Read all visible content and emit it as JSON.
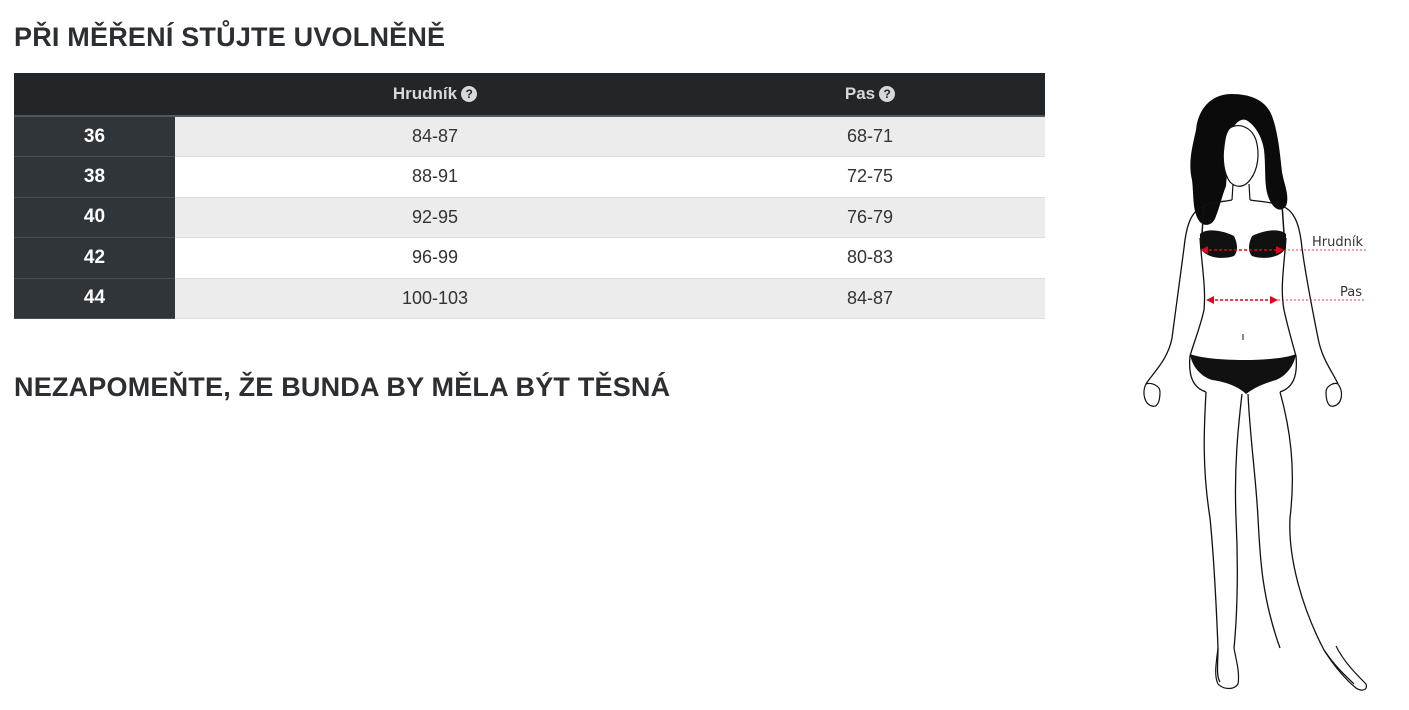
{
  "headings": {
    "measure": "PŘI MĚŘENÍ STŮJTE UVOLNĚNĚ",
    "reminder": "NEZAPOMEŇTE, ŽE BUNDA BY MĚLA BÝT TĚSNÁ"
  },
  "table": {
    "columns": [
      {
        "label": "",
        "icon": null
      },
      {
        "label": "Hrudník",
        "icon": "question-circle-icon"
      },
      {
        "label": "Pas",
        "icon": "question-circle-icon"
      }
    ],
    "rows": [
      {
        "size": "36",
        "hrudnik": "84-87",
        "pas": "68-71"
      },
      {
        "size": "38",
        "hrudnik": "88-91",
        "pas": "72-75"
      },
      {
        "size": "40",
        "hrudnik": "92-95",
        "pas": "76-79"
      },
      {
        "size": "42",
        "hrudnik": "96-99",
        "pas": "80-83"
      },
      {
        "size": "44",
        "hrudnik": "100-103",
        "pas": "84-87"
      }
    ]
  },
  "figure": {
    "labels": {
      "chest": "Hrudník",
      "waist": "Pas"
    }
  },
  "colors": {
    "header_bg": "#232629",
    "size_cell_bg": "#30353a",
    "row_alt_bg": "#ececec",
    "measure_line": "#e2001a"
  }
}
